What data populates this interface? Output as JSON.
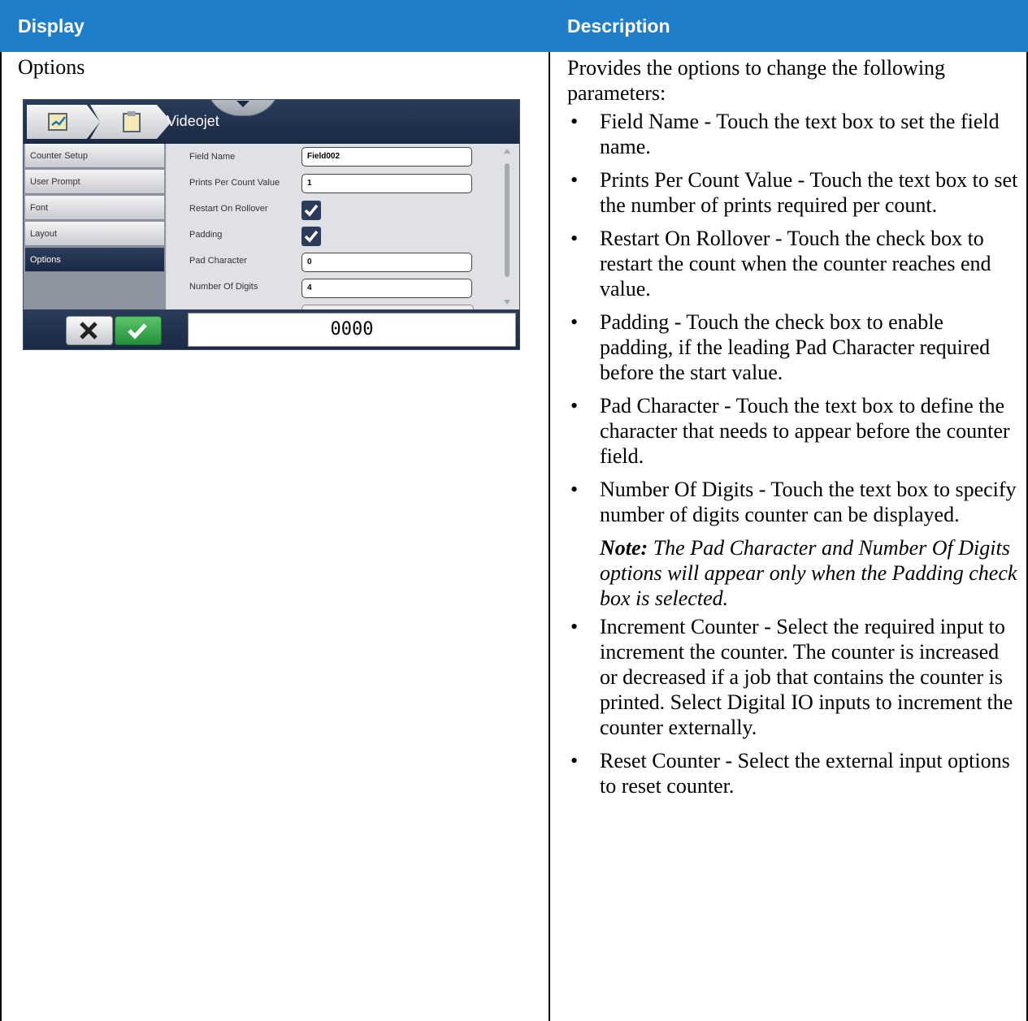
{
  "table": {
    "header_display": "Display",
    "header_description": "Description"
  },
  "row": {
    "title": "Options",
    "intro": "Provides the options to change the following parameters:",
    "bullets": [
      "Field Name - Touch the text box to set the field name.",
      "Prints Per Count Value - Touch the text box to set the number of prints required per count.",
      "Restart On Rollover - Touch the check box to restart the count when the counter reaches end value.",
      "Padding - Touch the check box to enable padding, if the leading Pad Character required before the start value.",
      "Pad Character - Touch the text box to define the character that needs to appear before the counter field.",
      "Number Of Digits - Touch the text box to specify number of digits counter can be displayed."
    ],
    "note_label": "Note:",
    "note_text": "The Pad Character and Number Of Digits options will appear only when the Padding check box is selected.",
    "bullets2": [
      "Increment Counter - Select the required input to increment the counter. The counter is increased or decreased if a job that contains the counter is printed. Select Digital IO inputs to increment the counter externally.",
      "Reset Counter - Select the external input options to reset counter."
    ],
    "bullet_glyph": "•"
  },
  "screen": {
    "app_title": "Videojet",
    "sidebar": [
      "Counter Setup",
      "User Prompt",
      "Font",
      "Layout",
      "Options"
    ],
    "active_item": "Options",
    "fields": {
      "field_name_label": "Field Name",
      "field_name_value": "Field002",
      "prints_label": "Prints Per Count Value",
      "prints_value": "1",
      "restart_label": "Restart On Rollover",
      "restart_checked": true,
      "padding_label": "Padding",
      "padding_checked": true,
      "pad_char_label": "Pad Character",
      "pad_char_value": "0",
      "digits_label": "Number Of Digits",
      "digits_value": "4"
    },
    "preview_value": "0000",
    "icons": [
      "edit-icon",
      "clipboard-icon",
      "close-icon",
      "check-icon"
    ]
  },
  "colors": {
    "header_blue": "#1f7ec9",
    "screen_navy": "#1b2a44",
    "ok_green": "#24913a"
  }
}
